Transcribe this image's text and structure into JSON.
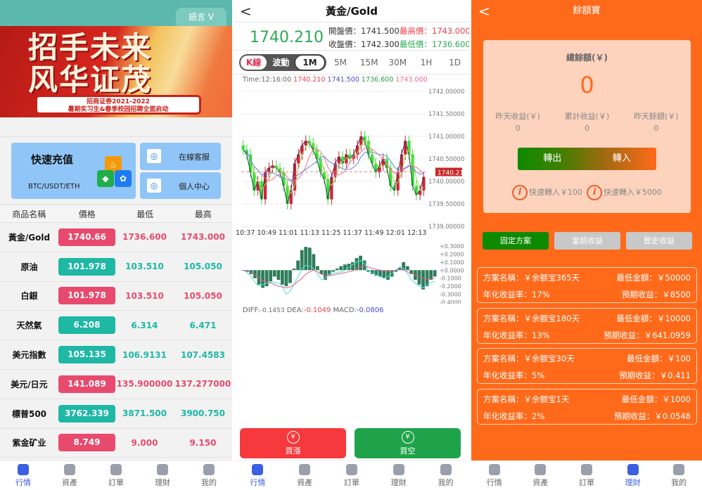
{
  "market": {
    "language_label": "語言 V",
    "banner": {
      "title_line1": "招手未来",
      "title_line2": "风华证茂",
      "subtitle_line1": "招商证劵2021-2022",
      "subtitle_line2": "暑期实习生&春季校园招聘全面启动"
    },
    "quick_recharge": {
      "title": "快速充值",
      "subtitle": "BTC/USDT/ETH"
    },
    "side_links": [
      {
        "label": "在線客服",
        "icon": "headset-icon"
      },
      {
        "label": "個人中心",
        "icon": "user-center-icon"
      }
    ],
    "table_headers": [
      "商品名稱",
      "價格",
      "最低",
      "最高"
    ],
    "rows": [
      {
        "name": "黃金/Gold",
        "price": "1740.66",
        "low": "1736.600",
        "high": "1743.000",
        "trend": "up"
      },
      {
        "name": "原油",
        "price": "101.978",
        "low": "103.510",
        "high": "105.050",
        "trend": "down"
      },
      {
        "name": "白銀",
        "price": "101.978",
        "low": "103.510",
        "high": "105.050",
        "trend": "up"
      },
      {
        "name": "天然氣",
        "price": "6.208",
        "low": "6.314",
        "high": "6.471",
        "trend": "down"
      },
      {
        "name": "美元指數",
        "price": "105.135",
        "low": "106.9131",
        "high": "107.4583",
        "trend": "down"
      },
      {
        "name": "美元/日元",
        "price": "141.089",
        "low": "135.900000",
        "high": "137.277000",
        "trend": "up"
      },
      {
        "name": "標普500",
        "price": "3762.339",
        "low": "3871.500",
        "high": "3900.750",
        "trend": "down"
      },
      {
        "name": "紫金矿业",
        "price": "8.749",
        "low": "9.000",
        "high": "9.150",
        "trend": "up"
      }
    ]
  },
  "tabbar": {
    "items": [
      {
        "label": "行情",
        "icon": "market-icon"
      },
      {
        "label": "資產",
        "icon": "assets-icon"
      },
      {
        "label": "訂單",
        "icon": "orders-icon"
      },
      {
        "label": "理財",
        "icon": "wallet-icon"
      },
      {
        "label": "我的",
        "icon": "profile-icon"
      }
    ]
  },
  "detail": {
    "title": "黃金/Gold",
    "last_price": "1740.210",
    "open_label": "開盤價：",
    "open": "1741.500",
    "high_label": "最高價：",
    "high": "1743.000",
    "close_label": "收盤價：",
    "close": "1742.300",
    "low_label": "最低價：",
    "low": "1736.600",
    "mode_tabs": [
      "K線",
      "波動"
    ],
    "periods": [
      "1M",
      "5M",
      "15M",
      "30M",
      "1H",
      "1D"
    ],
    "active_period": "1M",
    "kline_info": {
      "time_label": "Time:",
      "time": "12:16:00",
      "close": "1740.210",
      "open": "1741.500",
      "low": "1736.600",
      "high": "1743.000"
    },
    "price_tag": "1740.21",
    "macd_info": {
      "diff_label": "DIFF:",
      "diff": "-0.1453",
      "dea_label": "DEA:",
      "dea": "-0.1049",
      "macd_label": "MACD:",
      "macd": "-0.0806"
    },
    "buy_up": "買漲",
    "buy_down": "買空"
  },
  "chart_data": [
    {
      "type": "candlestick",
      "title": "黃金/Gold 1M",
      "x_ticks": [
        "10:37",
        "10:49",
        "11:01",
        "11:13",
        "11:25",
        "11:37",
        "11:49",
        "12:01",
        "12:13"
      ],
      "y_ticks": [
        "1742.00000",
        "1741.50000",
        "1741.00000",
        "1740.50000",
        "1740.00000",
        "1739.50000",
        "1739.00000"
      ],
      "ylim": [
        1739.0,
        1742.0
      ],
      "current_price_line": 1740.21,
      "close_series": [
        1740.7,
        1740.6,
        1740.2,
        1739.8,
        1740.0,
        1739.6,
        1740.2,
        1740.3,
        1740.35,
        1740.3,
        1740.2,
        1739.9,
        1739.5,
        1739.8,
        1740.4,
        1740.6,
        1740.8,
        1740.9,
        1740.85,
        1740.7,
        1740.5,
        1740.2,
        1740.05,
        1739.6,
        1740.1,
        1740.4,
        1740.55,
        1740.4,
        1740.6,
        1740.5,
        1740.6,
        1740.8,
        1741.0,
        1740.9,
        1740.6,
        1740.4,
        1740.2,
        1740.35,
        1740.5,
        1740.3,
        1739.9,
        1739.8,
        1740.2,
        1740.6,
        1740.9,
        1740.6,
        1739.9,
        1739.7,
        1739.8,
        1740.1
      ]
    },
    {
      "type": "bar",
      "title": "MACD",
      "y_ticks": [
        "+0.3000",
        "+0.2000",
        "+0.1000",
        "+0.0000",
        "-0.1000",
        "-0.2000",
        "-0.3000",
        "-0.4000"
      ],
      "ylim": [
        -0.4,
        0.3
      ],
      "histogram": [
        0,
        -0.02,
        -0.05,
        -0.1,
        -0.18,
        -0.22,
        -0.2,
        -0.14,
        -0.08,
        -0.12,
        -0.18,
        -0.2,
        -0.16,
        0.02,
        0.12,
        0.25,
        0.29,
        0.28,
        0.2,
        0.05,
        -0.05,
        -0.12,
        -0.06,
        -0.02,
        0.02,
        0.05,
        0.07,
        0.08,
        0.1,
        0.15,
        0.18,
        0.12,
        -0.02,
        -0.05,
        -0.07,
        -0.08,
        -0.1,
        -0.12,
        -0.08,
        -0.02,
        0.03,
        0.1,
        0.05,
        -0.05,
        -0.12,
        -0.18,
        -0.24,
        -0.2,
        -0.12,
        -0.08
      ],
      "diff": [
        0,
        -0.03,
        -0.08,
        -0.15,
        -0.2,
        -0.18,
        -0.16,
        -0.15,
        -0.15,
        -0.16,
        -0.2,
        -0.3,
        -0.26,
        -0.18,
        -0.08,
        0.02,
        0.06,
        0.05,
        0.02,
        -0.05,
        -0.12,
        -0.1,
        -0.05,
        -0.04,
        -0.03,
        -0.02,
        0.0,
        0.03,
        0.07,
        0.1,
        0.12,
        0.08,
        0.0,
        -0.04,
        -0.06,
        -0.08,
        -0.1,
        -0.08,
        -0.04,
        0.0,
        0.04,
        0.02,
        -0.04,
        -0.12,
        -0.16,
        -0.2,
        -0.22,
        -0.18,
        -0.15,
        -0.14
      ],
      "dea": [
        0,
        -0.01,
        -0.03,
        -0.06,
        -0.1,
        -0.13,
        -0.15,
        -0.16,
        -0.18,
        -0.2,
        -0.21,
        -0.22,
        -0.21,
        -0.18,
        -0.14,
        -0.1,
        -0.05,
        -0.02,
        0.0,
        -0.02,
        -0.05,
        -0.07,
        -0.07,
        -0.06,
        -0.05,
        -0.04,
        -0.03,
        -0.02,
        -0.01,
        0.02,
        0.04,
        0.05,
        0.04,
        0.02,
        0.01,
        0.0,
        -0.01,
        -0.01,
        -0.01,
        0.0,
        0.01,
        0.0,
        -0.02,
        -0.04,
        -0.06,
        -0.08,
        -0.1,
        -0.11,
        -0.11,
        -0.1
      ]
    }
  ],
  "yuebao": {
    "title": "餘額寶",
    "total_label": "總餘額(￥)",
    "total": "0",
    "stats": [
      {
        "label": "昨天收益(￥)",
        "value": "0"
      },
      {
        "label": "累計收益(￥)",
        "value": "0"
      },
      {
        "label": "昨天餘額(￥)",
        "value": "0"
      }
    ],
    "transfer_out": "轉出",
    "transfer_in": "轉入",
    "quick_in": [
      "快速轉入￥100",
      "快速轉入￥5000"
    ],
    "plan_tabs": [
      "固定方案",
      "當前收益",
      "歷史收益"
    ],
    "plans": [
      {
        "name": "方案名稱：￥余额宝365天",
        "min": "最低金額：￥50000",
        "rate": "年化收益率：17%",
        "expected": "預期收益：￥8500"
      },
      {
        "name": "方案名稱：￥余额宝180天",
        "min": "最低金額：￥10000",
        "rate": "年化收益率：13%",
        "expected": "預期收益：￥641.0959"
      },
      {
        "name": "方案名稱：￥余额宝30天",
        "min": "最低金額：￥100",
        "rate": "年化收益率：5%",
        "expected": "預期收益：￥0.411"
      },
      {
        "name": "方案名稱：￥余额宝1天",
        "min": "最低金額：￥1000",
        "rate": "年化收益率：2%",
        "expected": "預期收益：￥0.0548"
      }
    ]
  }
}
